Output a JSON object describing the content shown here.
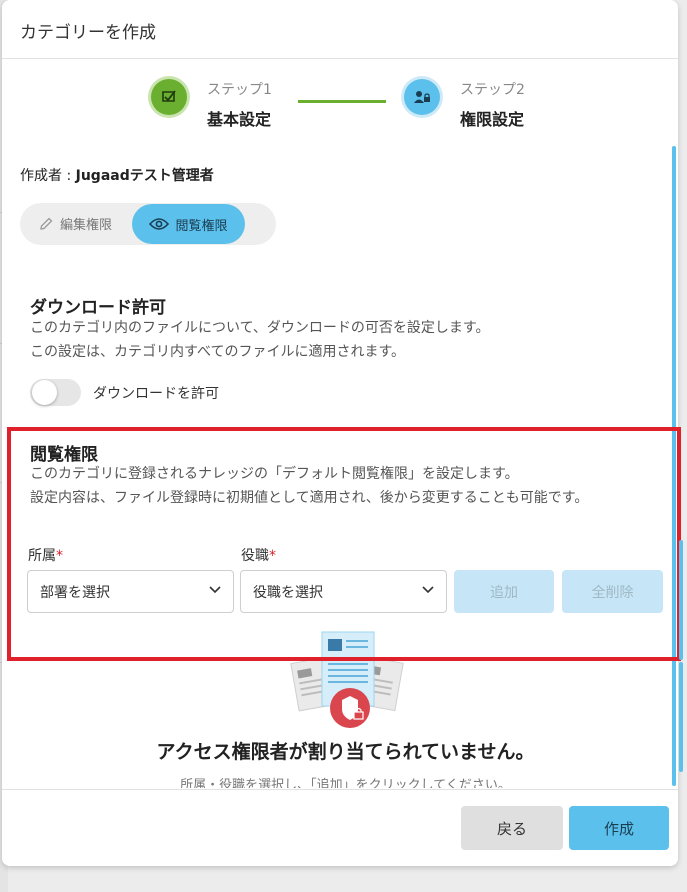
{
  "modal": {
    "title": "カテゴリーを作成"
  },
  "stepper": {
    "step1": {
      "small": "ステップ1",
      "label": "基本設定"
    },
    "step2": {
      "small": "ステップ2",
      "label": "権限設定"
    }
  },
  "creator": {
    "prefix": "作成者 : ",
    "name": "Jugaadテスト管理者"
  },
  "permission_tabs": {
    "edit": "編集権限",
    "view": "閲覧権限",
    "active": "view"
  },
  "download": {
    "title": "ダウンロード許可",
    "desc1": "このカテゴリ内のファイルについて、ダウンロードの可否を設定します。",
    "desc2": "この設定は、カテゴリ内すべてのファイルに適用されます。",
    "toggle_label": "ダウンロードを許可",
    "enabled": false
  },
  "view_permission": {
    "title": "閲覧権限",
    "desc1": "このカテゴリに登録されるナレッジの「デフォルト閲覧権限」を設定します。",
    "desc2": "設定内容は、ファイル登録時に初期値として適用され、後から変更することも可能です。",
    "dept_label": "所属",
    "role_label": "役職",
    "required_mark": "*",
    "dept_placeholder": "部署を選択",
    "role_placeholder": "役職を選択",
    "add_button": "追加",
    "clear_button": "全削除"
  },
  "empty_state": {
    "title": "アクセス権限者が割り当てられていません。",
    "desc": "所属・役職を選択し、「追加」をクリックしてください。"
  },
  "footer": {
    "back": "戻る",
    "create": "作成"
  },
  "colors": {
    "accent": "#5bc0eb",
    "step1": "#6aaf2f",
    "highlight": "#e0202a"
  }
}
